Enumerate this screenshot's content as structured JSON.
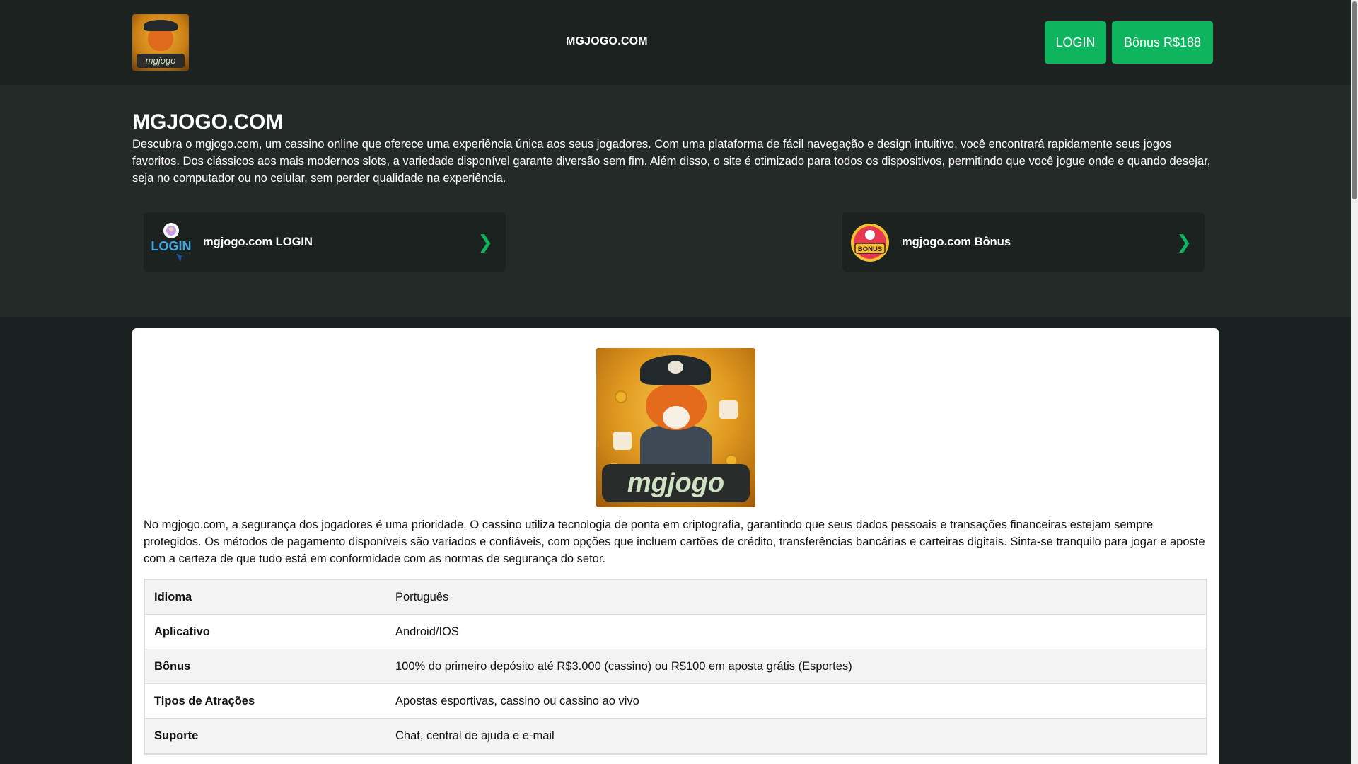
{
  "header": {
    "site_name": "MGJOGO.COM",
    "logo_text": "mgjogo",
    "login_label": "LOGIN",
    "bonus_label": "Bônus R$188"
  },
  "intro": {
    "title": "MGJOGO.COM",
    "description": "Descubra o mgjogo.com, um cassino online que oferece uma experiência única aos seus jogadores. Com uma plataforma de fácil navegação e design intuitivo, você encontrará rapidamente seus jogos favoritos. Dos clássicos aos mais modernos slots, a variedade disponível garante diversão sem fim. Além disso, o site é otimizado para todos os dispositivos, permitindo que você jogue onde e quando desejar, seja no computador ou no celular, sem perder qualidade na experiência.",
    "cards": [
      {
        "label": "mgjogo.com LOGIN",
        "icon": "login-icon",
        "icon_text": "LOGIN"
      },
      {
        "label": "mgjogo.com Bônus",
        "icon": "bonus-icon",
        "icon_text": "BONUS"
      }
    ],
    "chevron": "❯"
  },
  "content": {
    "hero_logo_text": "mgjogo",
    "paragraph": "No mgjogo.com, a segurança dos jogadores é uma prioridade. O cassino utiliza tecnologia de ponta em criptografia, garantindo que seus dados pessoais e transações financeiras estejam sempre protegidos. Os métodos de pagamento disponíveis são variados e confiáveis, com opções que incluem cartões de crédito, transferências bancárias e carteiras digitais. Sinta-se tranquilo para jogar e aposte com a certeza de que tudo está em conformidade com as normas de segurança do setor.",
    "table": [
      {
        "key": "Idioma",
        "value": "Português"
      },
      {
        "key": "Aplicativo",
        "value": "Android/IOS"
      },
      {
        "key": "Bônus",
        "value": "100% do primeiro depósito até R$3.000 (cassino) ou R$100 em aposta grátis (Esportes)"
      },
      {
        "key": "Tipos de Atrações",
        "value": "Apostas esportivas, cassino ou cassino ao vivo"
      },
      {
        "key": "Suporte",
        "value": "Chat, central de ajuda e e-mail"
      }
    ]
  },
  "colors": {
    "accent_green": "#0fb45f",
    "header_bg": "#1b2220",
    "intro_bg": "#232a28",
    "page_bg": "#1a2120"
  }
}
